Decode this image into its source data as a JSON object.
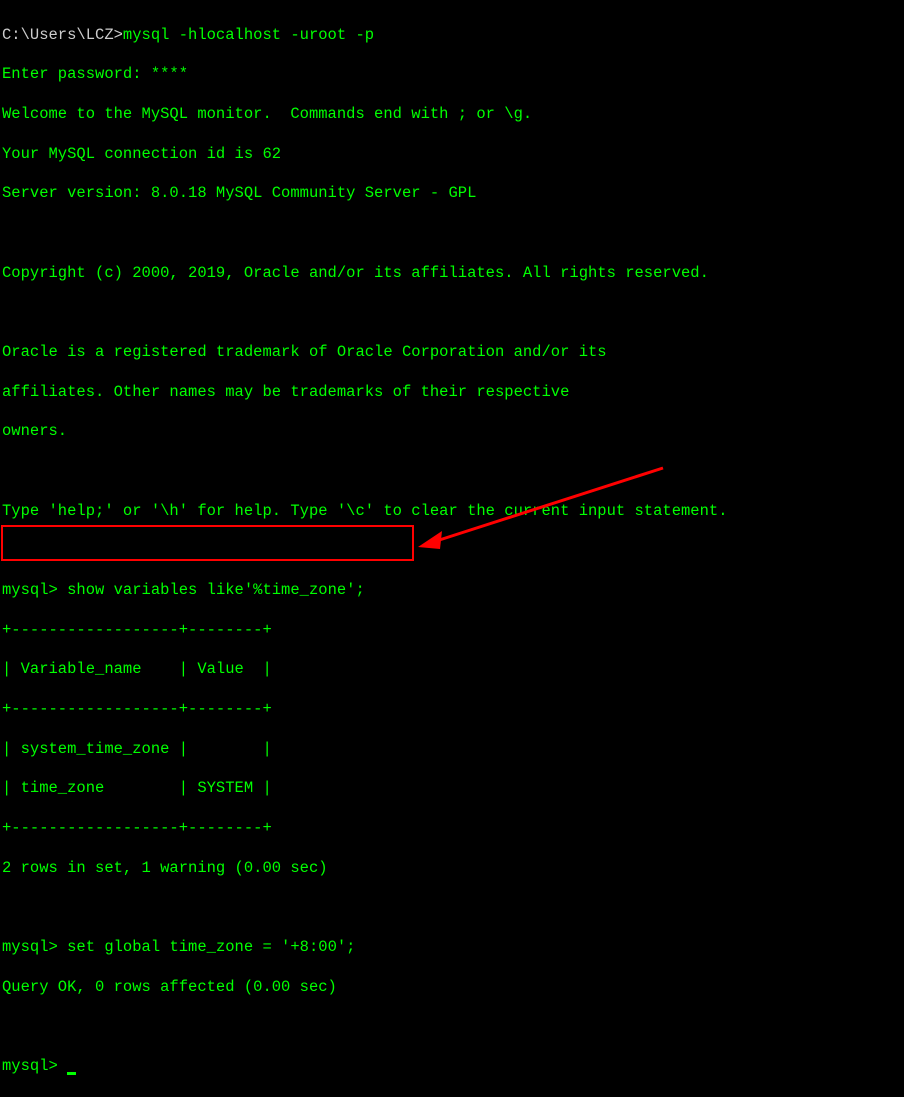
{
  "prompt_path": "C:\\Users\\LCZ>",
  "login_command": "mysql -hlocalhost -uroot -p",
  "password_prompt": "Enter password: ****",
  "welcome_line": "Welcome to the MySQL monitor.  Commands end with ; or \\g.",
  "connection_id": "Your MySQL connection id is 62",
  "server_version": "Server version: 8.0.18 MySQL Community Server - GPL",
  "copyright": "Copyright (c) 2000, 2019, Oracle and/or its affiliates. All rights reserved.",
  "trademark_line1": "Oracle is a registered trademark of Oracle Corporation and/or its",
  "trademark_line2": "affiliates. Other names may be trademarks of their respective",
  "trademark_line3": "owners.",
  "help_line": "Type 'help;' or '\\h' for help. Type '\\c' to clear the current input statement.",
  "mysql_prompt": "mysql> ",
  "query1": "show variables like'%time_zone';",
  "table": {
    "border_top": "+------------------+--------+",
    "header_row": "| Variable_name    | Value  |",
    "border_mid": "+------------------+--------+",
    "data_row1": "| system_time_zone |        |",
    "data_row2": "| time_zone        | SYSTEM |",
    "border_bottom": "+------------------+--------+"
  },
  "result1": "2 rows in set, 1 warning (0.00 sec)",
  "query2": "set global time_zone = '+8:00';",
  "result2": "Query OK, 0 rows affected (0.00 sec)",
  "chart_data": {
    "type": "table",
    "title": "MySQL SHOW VARIABLES LIKE '%time_zone' result",
    "columns": [
      "Variable_name",
      "Value"
    ],
    "rows": [
      {
        "Variable_name": "system_time_zone",
        "Value": ""
      },
      {
        "Variable_name": "time_zone",
        "Value": "SYSTEM"
      }
    ],
    "rows_in_set": 2,
    "warnings": 1,
    "elapsed_sec": 0.0
  }
}
